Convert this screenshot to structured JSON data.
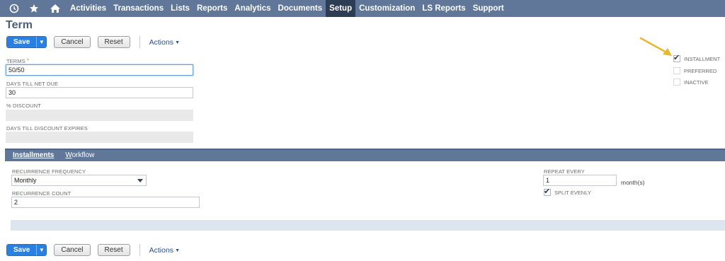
{
  "nav": {
    "icons": [
      "recent-icon",
      "star-icon",
      "home-icon"
    ],
    "items": [
      {
        "label": "Activities",
        "active": false
      },
      {
        "label": "Transactions",
        "active": false
      },
      {
        "label": "Lists",
        "active": false
      },
      {
        "label": "Reports",
        "active": false
      },
      {
        "label": "Analytics",
        "active": false
      },
      {
        "label": "Documents",
        "active": false
      },
      {
        "label": "Setup",
        "active": true
      },
      {
        "label": "Customization",
        "active": false
      },
      {
        "label": "LS Reports",
        "active": false
      },
      {
        "label": "Support",
        "active": false
      }
    ]
  },
  "page": {
    "title": "Term"
  },
  "toolbar": {
    "save": "Save",
    "cancel": "Cancel",
    "reset": "Reset",
    "actions": "Actions"
  },
  "form": {
    "terms": {
      "label": "TERMS",
      "required_mark": "*",
      "value": "50/50"
    },
    "days_till_net_due": {
      "label": "DAYS TILL NET DUE",
      "value": "30"
    },
    "discount": {
      "label": "% DISCOUNT",
      "value": ""
    },
    "days_till_discount_expires": {
      "label": "DAYS TILL DISCOUNT EXPIRES",
      "value": ""
    }
  },
  "checkboxes": {
    "installment": {
      "label": "INSTALLMENT",
      "checked": true
    },
    "preferred": {
      "label": "PREFERRED",
      "checked": false
    },
    "inactive": {
      "label": "INACTIVE",
      "checked": false
    }
  },
  "subtabs": {
    "installments": {
      "label": "Installments",
      "active": true
    },
    "workflow": {
      "first": "W",
      "rest": "orkflow",
      "active": false
    }
  },
  "installments": {
    "recurrence_frequency": {
      "label": "RECURRENCE FREQUENCY",
      "value": "Monthly"
    },
    "recurrence_count": {
      "label": "RECURRENCE COUNT",
      "value": "2"
    },
    "repeat_every": {
      "label": "REPEAT EVERY",
      "value": "1",
      "unit": "month(s)"
    },
    "split_evenly": {
      "label": "SPLIT EVENLY",
      "checked": true
    }
  },
  "colors": {
    "nav_bg": "#607799",
    "nav_active": "#2d3e54",
    "primary_button": "#2a7fe0",
    "hint_arrow": "#e8b830"
  }
}
